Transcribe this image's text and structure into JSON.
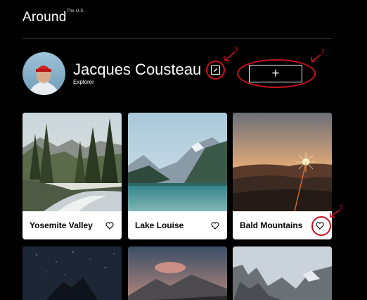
{
  "header": {
    "logo": "Around",
    "logo_superscript": "The U.S."
  },
  "profile": {
    "name": "Jacques Cousteau",
    "role": "Explorer",
    "edit_icon": "pencil-icon",
    "add_label": "+"
  },
  "annotations": [
    "1",
    "2",
    "3"
  ],
  "cards": [
    {
      "title": "Yosemite Valley",
      "icon": "heart-icon"
    },
    {
      "title": "Lake Louise",
      "icon": "heart-icon"
    },
    {
      "title": "Bald Mountains",
      "icon": "heart-icon"
    }
  ],
  "colors": {
    "background": "#000000",
    "card": "#ffffff",
    "annotation": "#d0101a"
  }
}
